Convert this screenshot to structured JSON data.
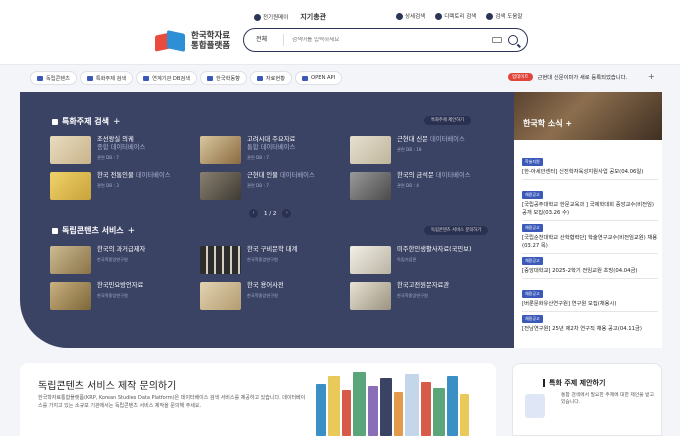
{
  "header": {
    "logo_line1": "한국학자료",
    "logo_line2": "통합플랫폼",
    "top_links": [
      {
        "label": "전기원메이",
        "icon": "user-icon"
      },
      {
        "label": "지기총관",
        "icon": "none"
      }
    ],
    "right_links": [
      {
        "label": "상세검색",
        "icon": "search-detail-icon"
      },
      {
        "label": "디렉토리 검색",
        "icon": "directory-icon"
      },
      {
        "label": "검색 도움말",
        "icon": "help-icon"
      }
    ],
    "search": {
      "scope": "전체",
      "placeholder": "검색어를 입력하세요"
    }
  },
  "nav": {
    "items": [
      {
        "label": "독립콘텐츠"
      },
      {
        "label": "특화주제 검색"
      },
      {
        "label": "연계기관 DB검색"
      },
      {
        "label": "한국학동향"
      },
      {
        "label": "자료현황"
      },
      {
        "label": "OPEN API"
      }
    ],
    "notice_tag": "업데이트",
    "notice_text": "근현대 신문이미가 새로 등록되었습니다."
  },
  "special": {
    "title": "특화주제 검색",
    "suggest_label": "특화주제 제안하기",
    "cards": [
      {
        "title": "조선왕실 의궤",
        "sub": "종합 데이터베이스",
        "meta": "관련 DB : 7"
      },
      {
        "title": "고려시대 주요자료",
        "sub": "통합 데이터베이스",
        "meta": "관련 DB : 7"
      },
      {
        "title": "근현대 신문",
        "sub": "데이터베이스",
        "meta": "관련 DB : 18"
      },
      {
        "title": "한국 전통인물",
        "sub": "데이터베이스",
        "meta": "관련 DB : 3"
      },
      {
        "title": "근현대 인물",
        "sub": "데이터베이스",
        "meta": "관련 DB : 7"
      },
      {
        "title": "한국의 금석문",
        "sub": "데이터베이스",
        "meta": "관련 DB : 4"
      }
    ],
    "pager": "1 / 2"
  },
  "indep": {
    "title": "독립콘텐츠 서비스",
    "inquiry_label": "독립콘텐츠 서비스 문의하기",
    "cards": [
      {
        "title": "한국의 과거급제자",
        "meta": "한국학중앙연구원"
      },
      {
        "title": "한국 구비문학 대계",
        "meta": "한국학중앙연구원"
      },
      {
        "title": "미주한인생활사자료(국민보)",
        "meta": "독립기념관"
      },
      {
        "title": "한국민요방언자료",
        "meta": "한국학중앙연구원"
      },
      {
        "title": "한국 용어사전",
        "meta": "한국학중앙연구원"
      },
      {
        "title": "한국고전원문자료관",
        "meta": "한국학중앙연구원"
      }
    ]
  },
  "news": {
    "title": "한국학 소식",
    "items": [
      {
        "badge": "학술지원",
        "text": "[한-아세안센터] 신진학자육성지원사업 공모(04.06일)"
      },
      {
        "badge": "채용공고",
        "text": "[국립공주대학교 한문교육과 ] 국제학대회 중앙교수(비전임) 공개 모집(03.26 수)"
      },
      {
        "badge": "채용공고",
        "text": "[국립순천대학교 산학협력단] 학술연구교수(비전임교원) 채용(03.27 목)"
      },
      {
        "badge": "채용공고",
        "text": "[중앙대학교] 2025-2학기 전임교원 초빙(04.04금)"
      },
      {
        "badge": "채용공고",
        "text": "[버룬문화유산연구원] 연구원 모집(채용시)"
      },
      {
        "badge": "채용공고",
        "text": "[전남연구원] 25년 제2차 연구직 채용 공고(04.11금)"
      }
    ]
  },
  "bottom": {
    "title": "독립콘텐츠 서비스 제작 문의하기",
    "text": "한국학자료통합플랫폼(KRP, Korean Studies Data Platform)은 데이터베이스 검색 서비스를 제공하고 있습니다. 데이터베이스를 가지고 있는 소규모 기관에서는 독립콘텐츠 서비스 제작을 문의해 주세요.",
    "right_title": "특화 주제 제안하기",
    "right_text": "통합 검색에서 필요한 주제에 대한 제안을 받고 있습니다."
  },
  "colors": {
    "panel": "#3b4365",
    "accent": "#3a59b8",
    "notice": "#e0443a"
  }
}
